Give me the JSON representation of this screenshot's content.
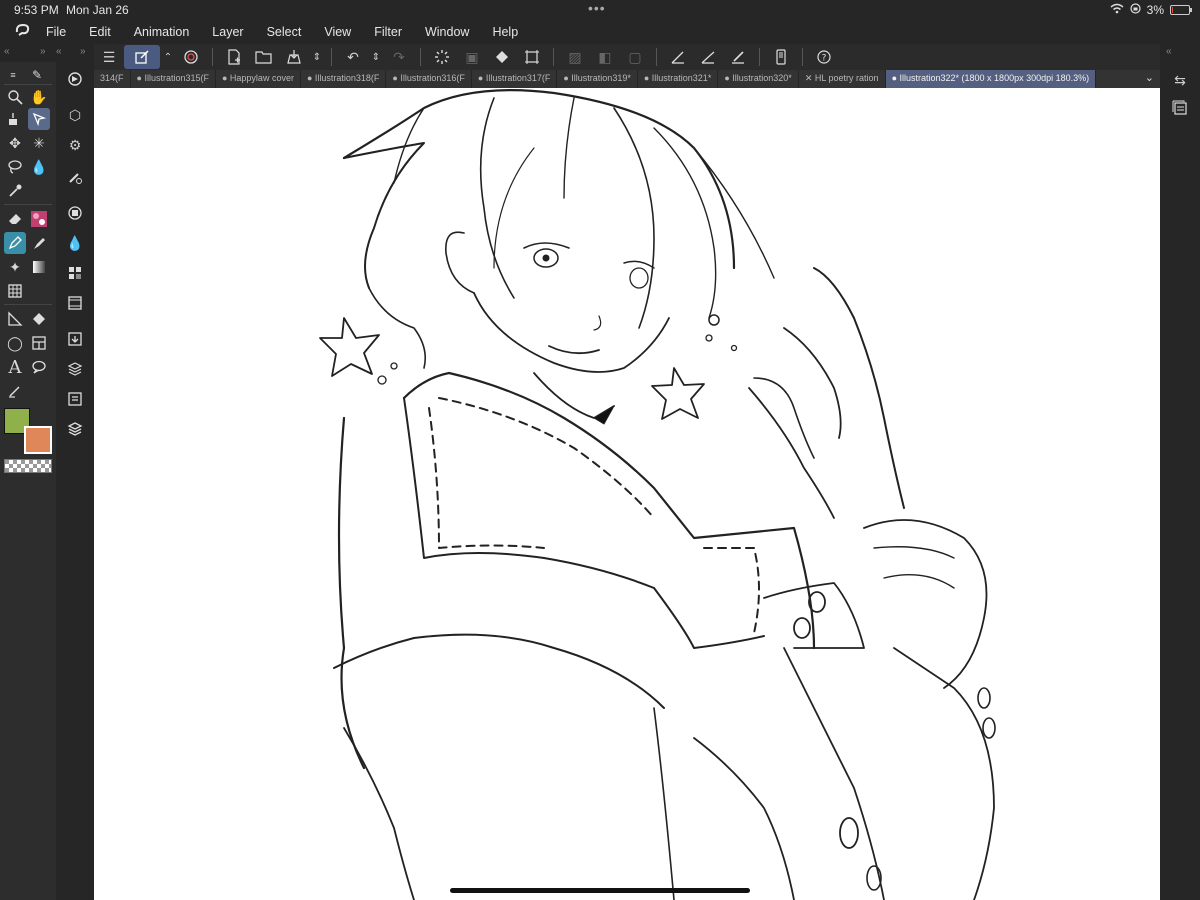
{
  "status": {
    "time": "9:53 PM",
    "date": "Mon Jan 26",
    "battery": "3%",
    "battery_level": 0.03
  },
  "menu": {
    "logo_icon": "clip-studio-logo-icon",
    "items": [
      "File",
      "Edit",
      "Animation",
      "Layer",
      "Select",
      "View",
      "Filter",
      "Window",
      "Help"
    ]
  },
  "tabs": {
    "items": [
      "314(F",
      "● Illustration315(F",
      "● Happylaw cover",
      "● Illustration318(F",
      "● Illustration316(F",
      "● Illustration317(F",
      "● Illustration319*",
      "● Illustration321*",
      "● Illustration320*",
      "✕ HL poetry ration",
      "● Illustration322* (1800 x 1800px 300dpi 180.3%)"
    ],
    "active_index": 10
  },
  "colors": {
    "main_color": "#8fb04a",
    "sub_color": "#e0875a",
    "active_tool_bg": "#5a6a8a",
    "canvas_bg": "#ffffff"
  }
}
